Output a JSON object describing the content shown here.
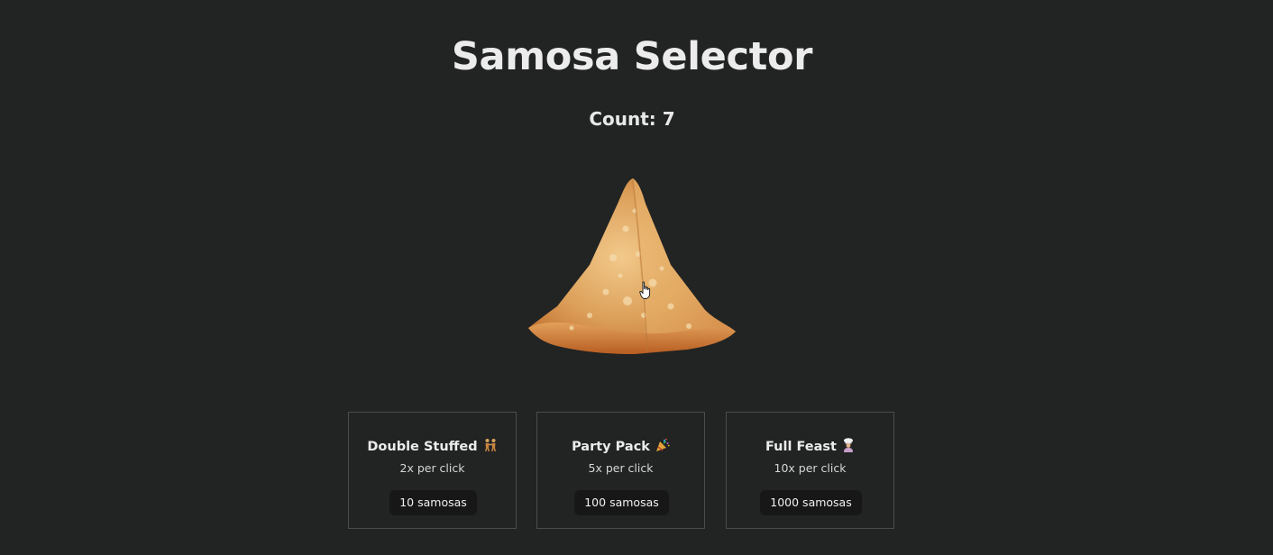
{
  "app": {
    "title": "Samosa Selector"
  },
  "counter": {
    "label": "Count: 7"
  },
  "samosa": {
    "icon": "samosa-image"
  },
  "upgrades": [
    {
      "name": "Double Stuffed",
      "emoji": "people-holding-hands",
      "rate": "2x per click",
      "cost": "10 samosas"
    },
    {
      "name": "Party Pack",
      "emoji": "party-popper",
      "rate": "5x per click",
      "cost": "100 samosas"
    },
    {
      "name": "Full Feast",
      "emoji": "chef",
      "rate": "10x per click",
      "cost": "1000 samosas"
    }
  ],
  "colors": {
    "background": "#222323",
    "card_border": "#4a4b4b",
    "button_bg": "#171717"
  }
}
